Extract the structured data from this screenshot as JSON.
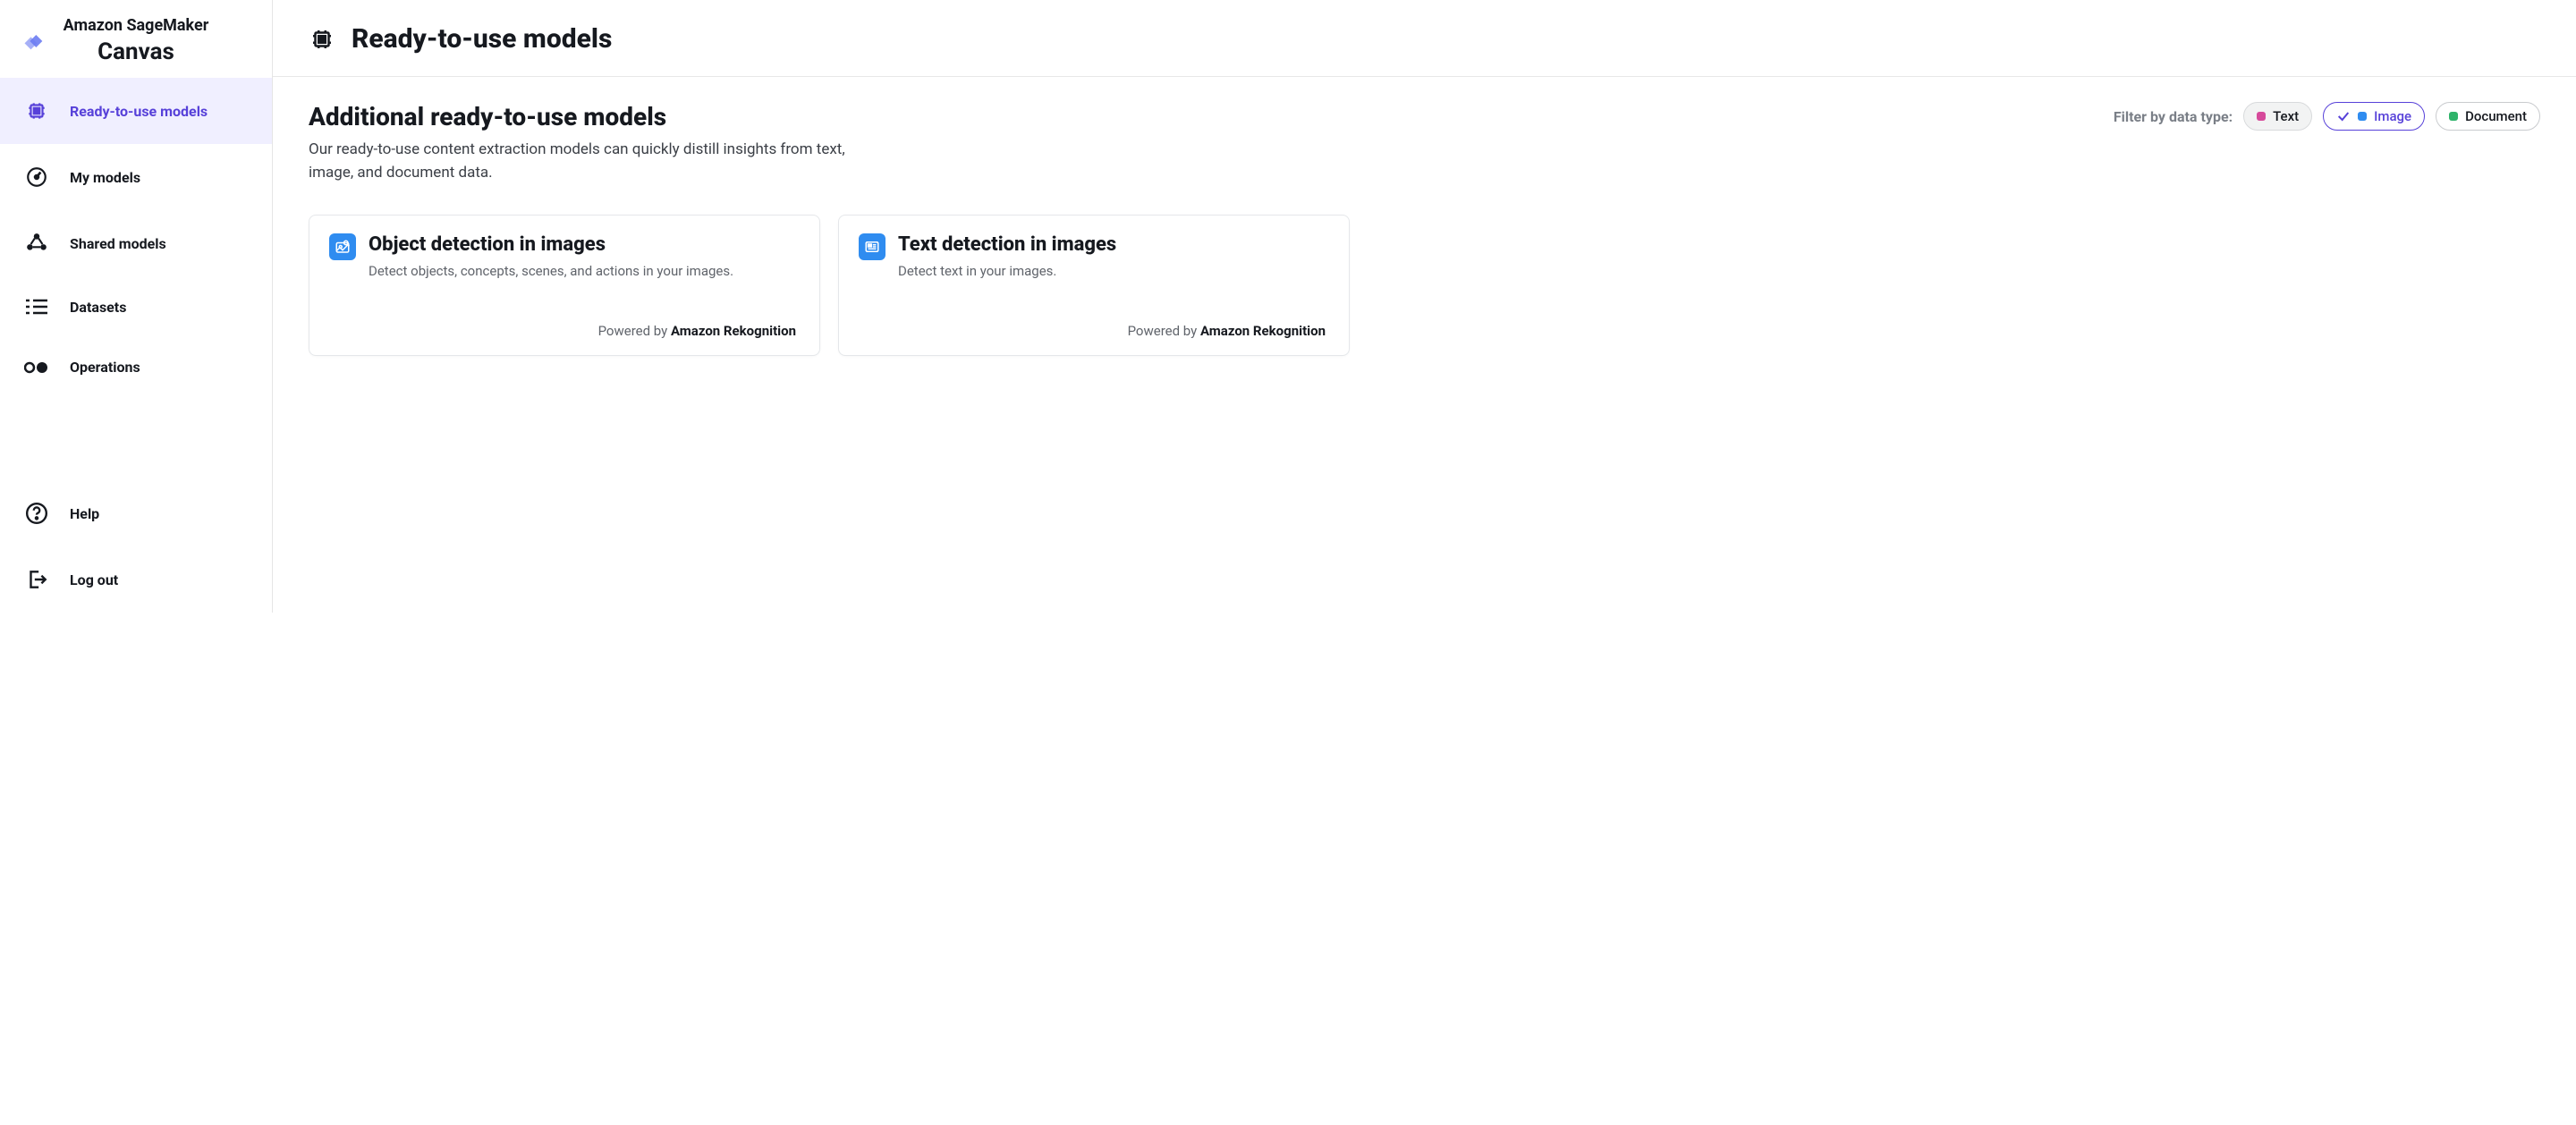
{
  "brand": {
    "title": "Amazon SageMaker",
    "sub": "Canvas"
  },
  "nav": {
    "items": [
      {
        "label": "Ready-to-use models"
      },
      {
        "label": "My models"
      },
      {
        "label": "Shared models"
      },
      {
        "label": "Datasets"
      },
      {
        "label": "Operations"
      }
    ],
    "bottom": [
      {
        "label": "Help"
      },
      {
        "label": "Log out"
      }
    ]
  },
  "page": {
    "title": "Ready-to-use models"
  },
  "section": {
    "title": "Additional ready-to-use models",
    "desc": "Our ready-to-use content extraction models can quickly distill insights from text, image, and document data."
  },
  "filters": {
    "label": "Filter by data type:",
    "options": [
      {
        "label": "Text",
        "dot": "#d64a9b"
      },
      {
        "label": "Image",
        "dot": "#2f8cf0"
      },
      {
        "label": "Document",
        "dot": "#2fb36a"
      }
    ]
  },
  "cards": [
    {
      "title": "Object detection in images",
      "desc": "Detect objects, concepts, scenes, and actions in your images.",
      "powered_by_prefix": "Powered by ",
      "powered_by": "Amazon Rekognition"
    },
    {
      "title": "Text detection in images",
      "desc": "Detect text in your images.",
      "powered_by_prefix": "Powered by ",
      "powered_by": "Amazon Rekognition"
    }
  ]
}
